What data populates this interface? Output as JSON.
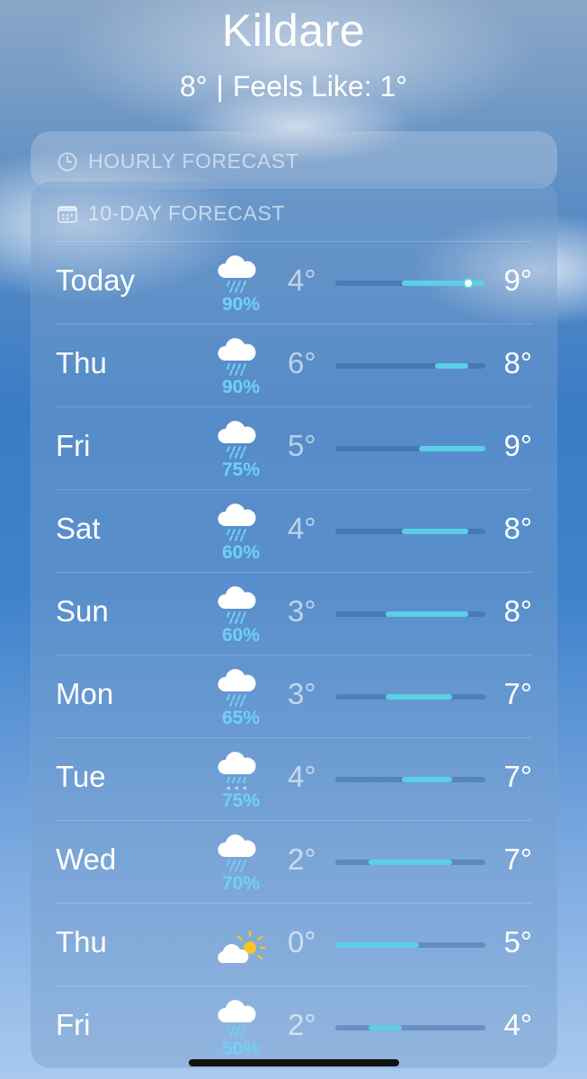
{
  "location": {
    "city": "Kildare",
    "temp": "8°",
    "separator": "|",
    "feels_like": "Feels Like: 1°"
  },
  "hourly": {
    "title": "HOURLY FORECAST",
    "icon": "clock-icon"
  },
  "daily": {
    "title": "10-DAY FORECAST",
    "icon": "calendar-icon",
    "range_min": 0,
    "range_max": 9,
    "current_temp": 8,
    "days": [
      {
        "day": "Today",
        "icon": "rain-icon",
        "pct": "90%",
        "lo": "4°",
        "hi": "9°",
        "lo_val": 4,
        "hi_val": 9
      },
      {
        "day": "Thu",
        "icon": "rain-icon",
        "pct": "90%",
        "lo": "6°",
        "hi": "8°",
        "lo_val": 6,
        "hi_val": 8
      },
      {
        "day": "Fri",
        "icon": "rain-icon",
        "pct": "75%",
        "lo": "5°",
        "hi": "9°",
        "lo_val": 5,
        "hi_val": 9
      },
      {
        "day": "Sat",
        "icon": "rain-icon",
        "pct": "60%",
        "lo": "4°",
        "hi": "8°",
        "lo_val": 4,
        "hi_val": 8
      },
      {
        "day": "Sun",
        "icon": "rain-icon",
        "pct": "60%",
        "lo": "3°",
        "hi": "8°",
        "lo_val": 3,
        "hi_val": 8
      },
      {
        "day": "Mon",
        "icon": "rain-icon",
        "pct": "65%",
        "lo": "3°",
        "hi": "7°",
        "lo_val": 3,
        "hi_val": 7
      },
      {
        "day": "Tue",
        "icon": "sleet-icon",
        "pct": "75%",
        "lo": "4°",
        "hi": "7°",
        "lo_val": 4,
        "hi_val": 7
      },
      {
        "day": "Wed",
        "icon": "rain-icon",
        "pct": "70%",
        "lo": "2°",
        "hi": "7°",
        "lo_val": 2,
        "hi_val": 7
      },
      {
        "day": "Thu",
        "icon": "partly-sunny-icon",
        "pct": "",
        "lo": "0°",
        "hi": "5°",
        "lo_val": 0,
        "hi_val": 5
      },
      {
        "day": "Fri",
        "icon": "rain-icon",
        "pct": "50%",
        "lo": "2°",
        "hi": "4°",
        "lo_val": 2,
        "hi_val": 4
      }
    ]
  },
  "colors": {
    "precip": "#6fd1f5",
    "bar_fill": "#5ccfe6",
    "sun": "#f7c325"
  }
}
